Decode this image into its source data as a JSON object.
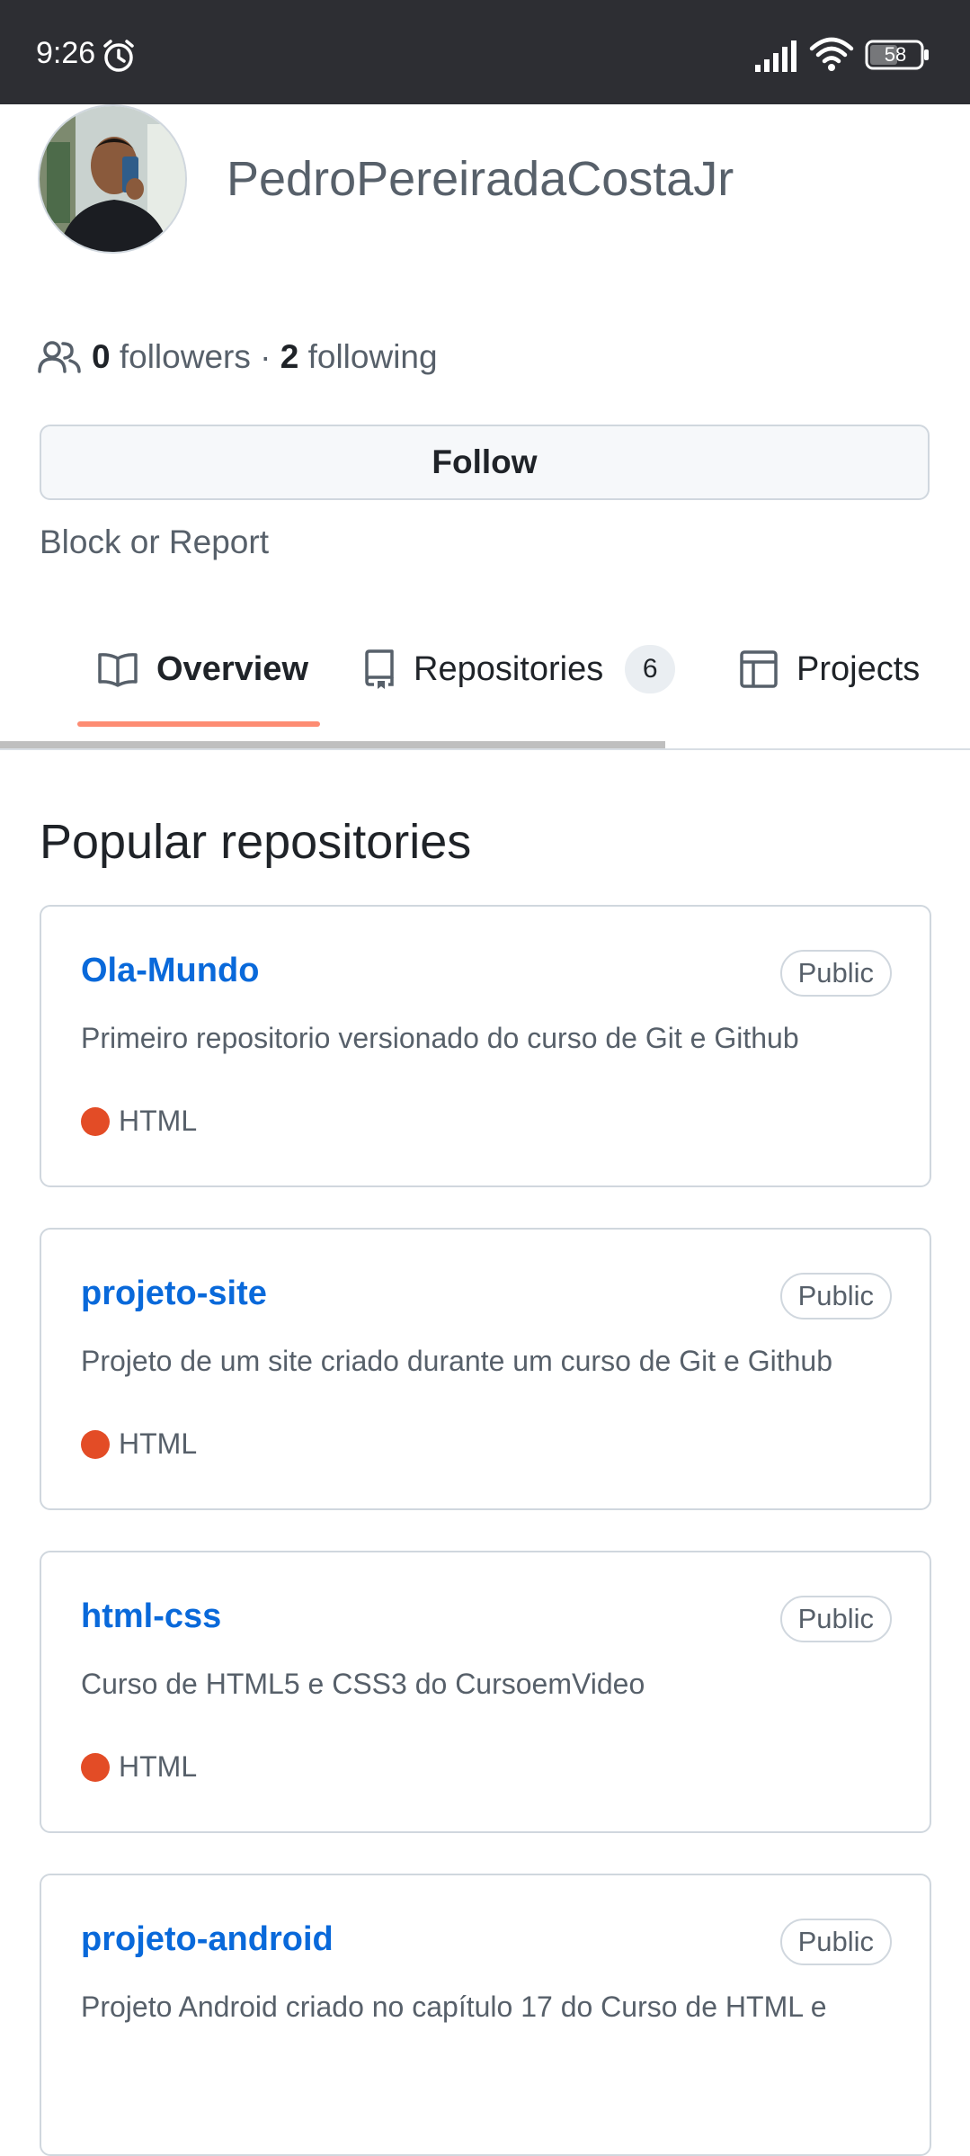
{
  "status_bar": {
    "time": "9:26",
    "battery": "58",
    "icons": [
      "alarm-icon",
      "signal-icon",
      "wifi-icon",
      "battery-icon"
    ]
  },
  "profile": {
    "username": "PedroPereiradaCostaJr",
    "followers_count": "0",
    "followers_label": "followers",
    "separator": "·",
    "following_count": "2",
    "following_label": "following",
    "follow_button": "Follow",
    "block_report": "Block or Report"
  },
  "tabs": {
    "overview": "Overview",
    "repositories": "Repositories",
    "repositories_count": "6",
    "projects": "Projects"
  },
  "popular": {
    "title": "Popular repositories",
    "repos": [
      {
        "name": "Ola-Mundo",
        "visibility": "Public",
        "description": "Primeiro repositorio versionado do curso de Git e Github",
        "language": "HTML"
      },
      {
        "name": "projeto-site",
        "visibility": "Public",
        "description": "Projeto de um site criado durante um curso de Git e Github",
        "language": "HTML"
      },
      {
        "name": "html-css",
        "visibility": "Public",
        "description": "Curso de HTML5 e CSS3 do CursoemVideo",
        "language": "HTML"
      },
      {
        "name": "projeto-android",
        "visibility": "Public",
        "description": "Projeto Android criado no capítulo 17 do Curso de HTML e",
        "language": ""
      }
    ]
  },
  "colors": {
    "link": "#0969da",
    "tab_underline": "#fd8c73",
    "html_language": "#e34c26",
    "status_bar": "#2d2e33"
  }
}
